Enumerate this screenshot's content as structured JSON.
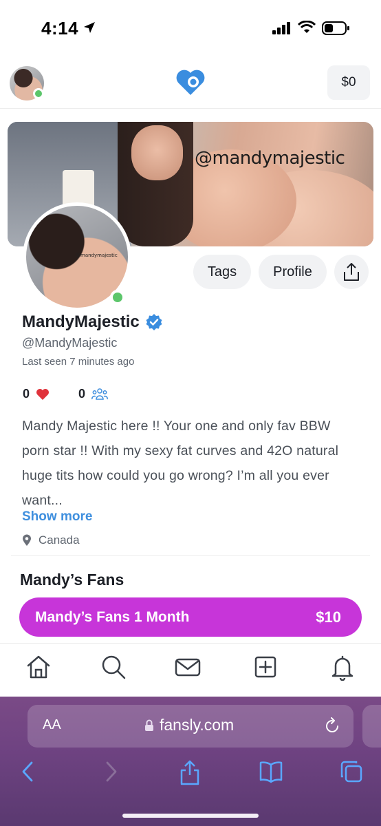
{
  "status_bar": {
    "time": "4:14"
  },
  "top_bar": {
    "wallet_label": "$0",
    "logo_icon": "fansly-heart-logo-icon"
  },
  "banner": {
    "watermark": "@mandymajestic"
  },
  "avatar": {
    "watermark": "@mandymajestic"
  },
  "actions": {
    "tags_label": "Tags",
    "profile_label": "Profile",
    "share_icon": "share-icon"
  },
  "profile": {
    "display_name": "MandyMajestic",
    "handle": "@MandyMajestic",
    "last_seen": "Last seen 7 minutes ago",
    "likes_count": "0",
    "followers_count": "0",
    "bio": "Mandy Majestic here !! Your one and only fav BBW porn star !! With my sexy fat curves and 42O natural huge tits how could you go wrong? I’m all you ever want...",
    "show_more_label": "Show more",
    "location": "Canada"
  },
  "subscriptions": {
    "section_title": "Mandy’s Fans",
    "tier_name": "Mandy’s Fans 1 Month",
    "tier_price": "$10",
    "accent_color": "#c735d9"
  },
  "bottom_nav": [
    "home-icon",
    "search-icon",
    "messages-icon",
    "create-post-icon",
    "notifications-icon"
  ],
  "browser": {
    "text_size_label": "AA",
    "url": "fansly.com",
    "toolbar": [
      "back-icon",
      "forward-icon",
      "share-icon",
      "bookmarks-icon",
      "tabs-icon"
    ]
  },
  "colors": {
    "link_blue": "#3f8fde",
    "online_green": "#5cc66b",
    "browser_purple": "#6f4382"
  }
}
